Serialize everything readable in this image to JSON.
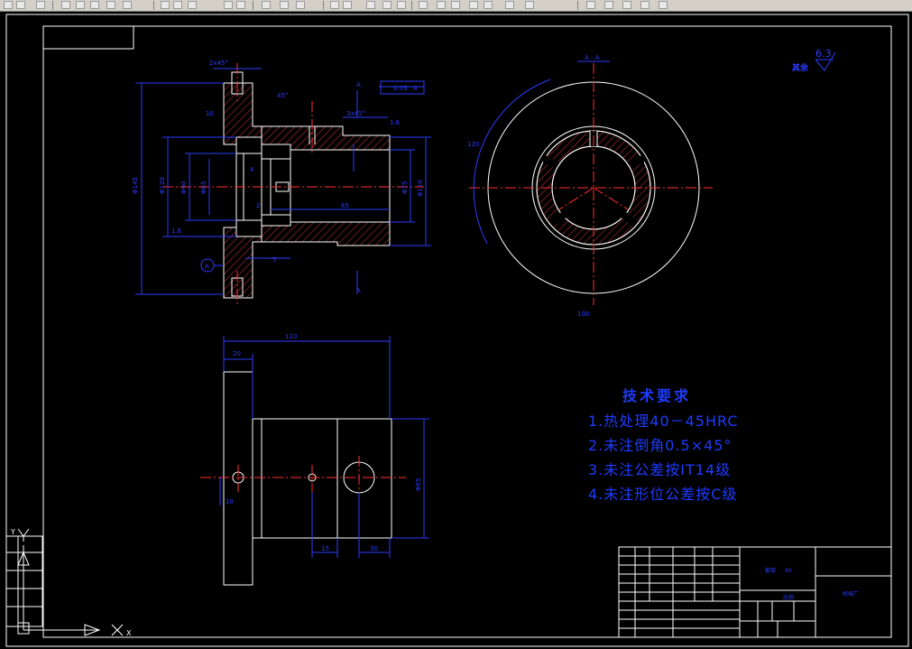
{
  "view_label": "A - A",
  "roughness": {
    "label": "其余",
    "value": "6.3"
  },
  "dimensions": {
    "top_width": "2x45°",
    "chamfer_top": "45°",
    "flange_note": "3x45°",
    "datum_tol": "0.03",
    "datum": "A",
    "section_letter": "A",
    "angle": "1.6",
    "small_dim": "1.6",
    "d30": "30",
    "d10": "10",
    "d5": "5",
    "d2": "2",
    "d4": "4",
    "d65": "65",
    "dia110": "Φ110",
    "dia100": "Φ100",
    "dia120": "120",
    "dia100b": "100",
    "front_110": "110",
    "front_20": "20",
    "front_30": "30",
    "front_15": "15",
    "front_30b": "30",
    "front_h": "Φ65",
    "left_dims": [
      "Φ145",
      "Φ120",
      "Φ90",
      "Φ65",
      "Φ75"
    ]
  },
  "tech_requirements": {
    "title": "技术要求",
    "items": [
      "1.热处理40－45HRC",
      "2.未注倒角0.5×45°",
      "3.未注公差按IT14级",
      "4.未注形位公差按C级"
    ]
  },
  "title_block": {
    "part_name": "套筒",
    "material": "45",
    "scale": "比例",
    "company": "机械厂"
  },
  "ucs": {
    "x_label": "X",
    "y_label": "Y"
  },
  "colors": {
    "background": "#000000",
    "frame": "#ffffff",
    "dimension": "#2b3cff",
    "center": "#ff2a2a",
    "hatch": "#9b2a2a"
  }
}
